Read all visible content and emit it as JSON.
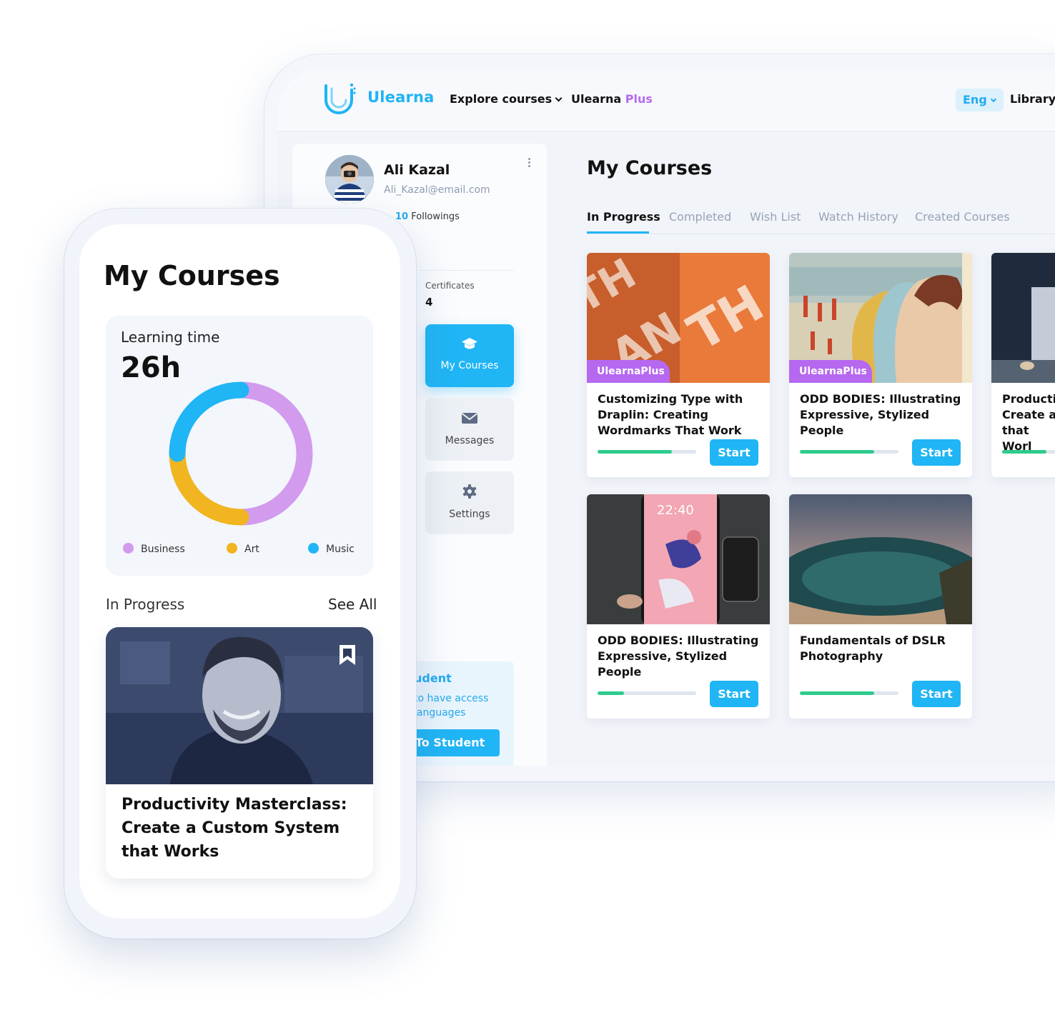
{
  "desktop": {
    "brand": "Ulearna",
    "nav": {
      "explore": "Explore courses",
      "plus_prefix": "Ulearna",
      "plus_suffix": "Plus",
      "language": "Eng",
      "library": "Library"
    },
    "profile": {
      "name": "Ali Kazal",
      "email": "Ali_Kazal@email.com",
      "followings_count": "10",
      "followings_label": "Followings",
      "certificates_label": "Certificates",
      "certificates_value": "4"
    },
    "sidebar_menu": [
      {
        "label": "My Courses",
        "icon": "graduation-cap-icon",
        "active": true
      },
      {
        "label": "Messages",
        "icon": "envelope-icon",
        "active": false
      },
      {
        "label": "Settings",
        "icon": "gear-icon",
        "active": false
      }
    ],
    "promo": {
      "title": "udent",
      "text": "to have access languages",
      "button": "To Student"
    },
    "page_title": "My Courses",
    "tabs": [
      "In Progress",
      "Completed",
      "Wish List",
      "Watch History",
      "Created Courses"
    ],
    "active_tab": "In Progress",
    "courses": [
      {
        "title": "Customizing Type with Draplin: Creating Wordmarks That Work",
        "badge": "UlearnaPlus",
        "progress": 0.75,
        "action": "Start"
      },
      {
        "title": "ODD BODIES: Illustrating Expressive, Stylized People",
        "badge": "UlearnaPlus",
        "progress": 0.75,
        "action": "Start"
      },
      {
        "title": "Productiv Create a  that Worl",
        "badge": "",
        "progress": 0.45,
        "action": "Start"
      },
      {
        "title": "ODD BODIES: Illustrating Expressive, Stylized People",
        "badge": "",
        "progress": 0.27,
        "action": "Start"
      },
      {
        "title": "Fundamentals of DSLR Photography",
        "badge": "",
        "progress": 0.75,
        "action": "Start"
      }
    ],
    "thumb_clock_text": "22:40"
  },
  "mobile": {
    "title": "My Courses",
    "learning_time_label": "Learning time",
    "learning_time_value": "26h",
    "chart_data": {
      "type": "pie",
      "categories": [
        "Business",
        "Art",
        "Music"
      ],
      "values": [
        50,
        25,
        25
      ],
      "colors": [
        "#d29bee",
        "#f0b520",
        "#20b5f5"
      ],
      "legend": "bottom"
    },
    "section_label": "In Progress",
    "see_all": "See All",
    "featured_course": "Productivity Masterclass: Create a Custom System that Works"
  },
  "colors": {
    "accent": "#20b5f5",
    "plus_purple": "#b668f0",
    "progress_green": "#2ecc8d"
  }
}
